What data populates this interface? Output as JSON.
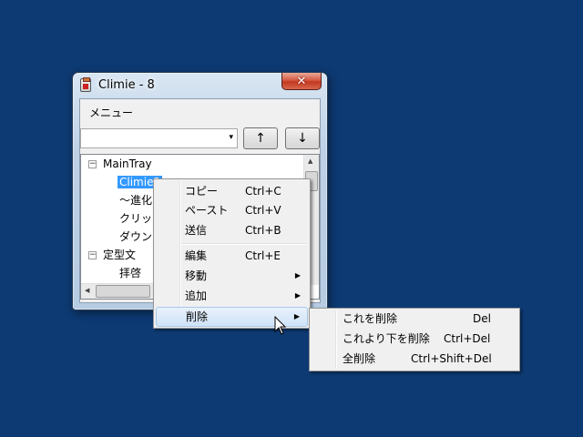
{
  "window": {
    "title": "Climie - 8",
    "close_glyph": "✕"
  },
  "menubar": {
    "menu_label": "メニュー"
  },
  "toolbar": {
    "combo_value": "",
    "combo_arrow": "▾",
    "up_label": "↑",
    "down_label": "↓"
  },
  "tree": {
    "nodes": [
      {
        "text": "MainTray",
        "expander": "−"
      },
      {
        "text": "Climie2"
      },
      {
        "text": "～進化"
      },
      {
        "text": "クリッ"
      },
      {
        "text": "ダウン"
      },
      {
        "text": "定型文",
        "expander": "−"
      },
      {
        "text": "拝啓"
      }
    ]
  },
  "context_menu": {
    "items": [
      {
        "label": "コピー",
        "shortcut": "Ctrl+C"
      },
      {
        "label": "ペースト",
        "shortcut": "Ctrl+V"
      },
      {
        "label": "送信",
        "shortcut": "Ctrl+B"
      },
      {
        "label": "編集",
        "shortcut": "Ctrl+E"
      },
      {
        "label": "移動",
        "arrow": "▶"
      },
      {
        "label": "追加",
        "arrow": "▶"
      },
      {
        "label": "削除",
        "arrow": "▶"
      }
    ]
  },
  "submenu": {
    "items": [
      {
        "label": "これを削除",
        "shortcut": "Del"
      },
      {
        "label": "これより下を削除",
        "shortcut": "Ctrl+Del"
      },
      {
        "label": "全削除",
        "shortcut": "Ctrl+Shift+Del"
      }
    ]
  },
  "colors": {
    "desktop": "#0d3a73",
    "selection": "#3399ff"
  }
}
